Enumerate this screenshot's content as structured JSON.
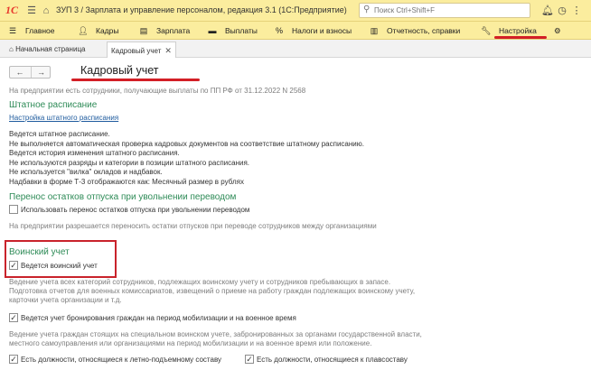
{
  "titlebar": {
    "logo": "1С",
    "title": "ЗУП 3 / Зарплата и управление персоналом, редакция 3.1  (1С:Предприятие)",
    "search_placeholder": "Поиск Ctrl+Shift+F"
  },
  "menu": {
    "items": [
      {
        "label": "Главное",
        "icon": "menu-icon"
      },
      {
        "label": "Кадры",
        "icon": "people-icon"
      },
      {
        "label": "Зарплата",
        "icon": "money-icon"
      },
      {
        "label": "Выплаты",
        "icon": "wallet-icon"
      },
      {
        "label": "Налоги и взносы",
        "icon": "percent-icon"
      },
      {
        "label": "Отчетность, справки",
        "icon": "report-icon"
      },
      {
        "label": "Настройка",
        "icon": "wrench-icon"
      }
    ]
  },
  "tabs": {
    "home_label": "Начальная страница",
    "active_label": "Кадровый учет"
  },
  "page": {
    "title": "Кадровый учет",
    "info": "На предприятии есть сотрудники, получающие выплаты по ПП РФ от 31.12.2022 N 2568"
  },
  "staffing": {
    "heading": "Штатное расписание",
    "link": "Настройка штатного расписания",
    "lines": [
      "Ведется штатное расписание.",
      "Не выполняется автоматическая проверка кадровых документов на соответствие штатному расписанию.",
      "Ведется история изменения штатного расписания.",
      "Не используются разряды и категории в позиции штатного расписания.",
      "Не используется \"вилка\" окладов и надбавок.",
      "Надбавки в форме Т-3 отображаются как: Месячный размер в рублях"
    ]
  },
  "vacation": {
    "heading": "Перенос остатков отпуска при увольнении переводом",
    "checkbox_label": "Использовать перенос остатков отпуска при увольнении переводом",
    "note": "На предприятии разрешается переносить остатки отпусков при переводе сотрудников между организациями"
  },
  "military": {
    "heading": "Воинский учет",
    "checkbox_label": "Ведется воинский учет",
    "desc_lines": [
      "Ведение учета всех категорий сотрудников, подлежащих воинскому учету и сотрудников пребывающих в запасе.",
      "Подготовка отчетов для военных комиссариатов, извещений о приеме на работу граждан подлежащих воинскому учету,",
      "карточки учета организации и т.д."
    ],
    "reserve_label": "Ведется учет бронирования граждан на период мобилизации и на военное время",
    "reserve_desc": [
      "Ведение учета граждан стоящих на специальном воинском учете, забронированных за органами государственной власти,",
      "местного самоуправления или организациями на период мобилизации и на военное время или положение."
    ],
    "flight_label": "Есть должности, относящиеся к летно-подъемному составу",
    "ship_label": "Есть должности, относящиеся к плавсоставу"
  }
}
